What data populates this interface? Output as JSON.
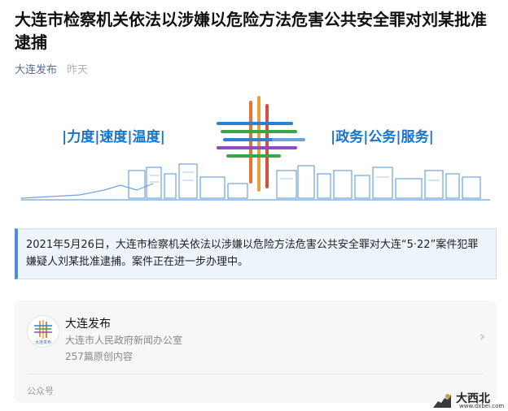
{
  "article": {
    "title": "大连市检察机关依法以涉嫌以危险方法危害公共安全罪对刘某批准逮捕",
    "source": "大连发布",
    "time": "昨天"
  },
  "banner": {
    "left_slogan": "|力度|速度|温度|",
    "right_slogan": "|政务|公务|服务|"
  },
  "notice": {
    "text": "2021年5月26日，大连市检察机关依法以涉嫌以危险方法危害公共安全罪对大连“5·22”案件犯罪嫌疑人刘某批准逮捕。案件正在进一步办理中。"
  },
  "account_card": {
    "name": "大连发布",
    "avatar_text": "大连发布",
    "org": "大连市人民政府新闻办公室",
    "count": "257篇原创内容",
    "type_label": "公众号",
    "chevron_icon": "chevron-right-icon"
  },
  "watermark": {
    "title": "大西北",
    "url": "www.dxbei.com"
  },
  "colors": {
    "banner_blue": "#1a73c9",
    "skyline": "#6fa3d6",
    "notice_bg": "#eef4fb",
    "link": "#576b95"
  }
}
